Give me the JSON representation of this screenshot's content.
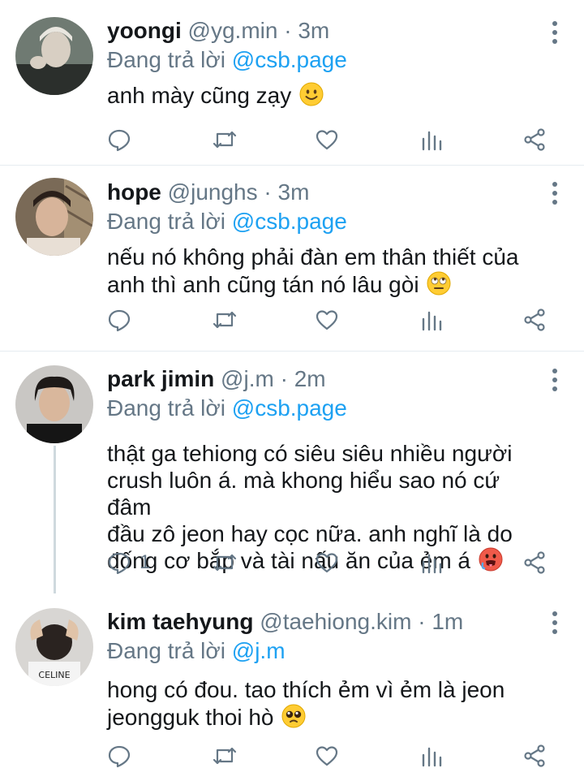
{
  "tweets": [
    {
      "name": "yoongi",
      "handle": "@yg.min",
      "separator": "·",
      "time": "3m",
      "replying_prefix": "Đang trả lời",
      "replying_to": "@csb.page",
      "text_lines": [
        "anh mày cũng zạy"
      ],
      "emoji": "slightly-smiling-face",
      "reply_count": ""
    },
    {
      "name": "hope",
      "handle": "@junghs",
      "separator": "·",
      "time": "3m",
      "replying_prefix": "Đang trả lời",
      "replying_to": "@csb.page",
      "text_lines": [
        "nếu nó không phải đàn em thân thiết của",
        "anh thì anh cũng tán nó lâu gòi"
      ],
      "emoji": "face-with-rolling-eyes",
      "reply_count": ""
    },
    {
      "name": "park jimin",
      "handle": "@j.m",
      "separator": "·",
      "time": "2m",
      "replying_prefix": "Đang trả lời",
      "replying_to": "@csb.page",
      "text_lines": [
        "thật ga tehiong có siêu siêu nhiều người",
        "crush luôn á. mà khong hiểu sao nó cứ đâm",
        "đầu zô jeon hay cọc nữa. anh nghĩ là do",
        "đống cơ bắp và tài nấu ăn của ẻm á"
      ],
      "emoji": "hot-face",
      "reply_count": "1"
    },
    {
      "name": "kim taehyung",
      "handle": "@taehiong.kim",
      "separator": "·",
      "time": "1m",
      "replying_prefix": "Đang trả lời",
      "replying_to": "@j.m",
      "text_lines": [
        "hong có đou. tao thích ẻm vì ẻm là jeon",
        "jeongguk thoi hò"
      ],
      "emoji": "pleading-face",
      "reply_count": ""
    }
  ],
  "icons": {
    "reply": "reply-icon",
    "retweet": "retweet-icon",
    "like": "like-icon",
    "analytics": "analytics-icon",
    "share": "share-icon",
    "more": "more-options-icon"
  },
  "colors": {
    "link": "#1da1f2",
    "muted": "#657786",
    "text": "#14171a",
    "divider": "#e6ecf0",
    "thread_line": "#cfd9de"
  }
}
